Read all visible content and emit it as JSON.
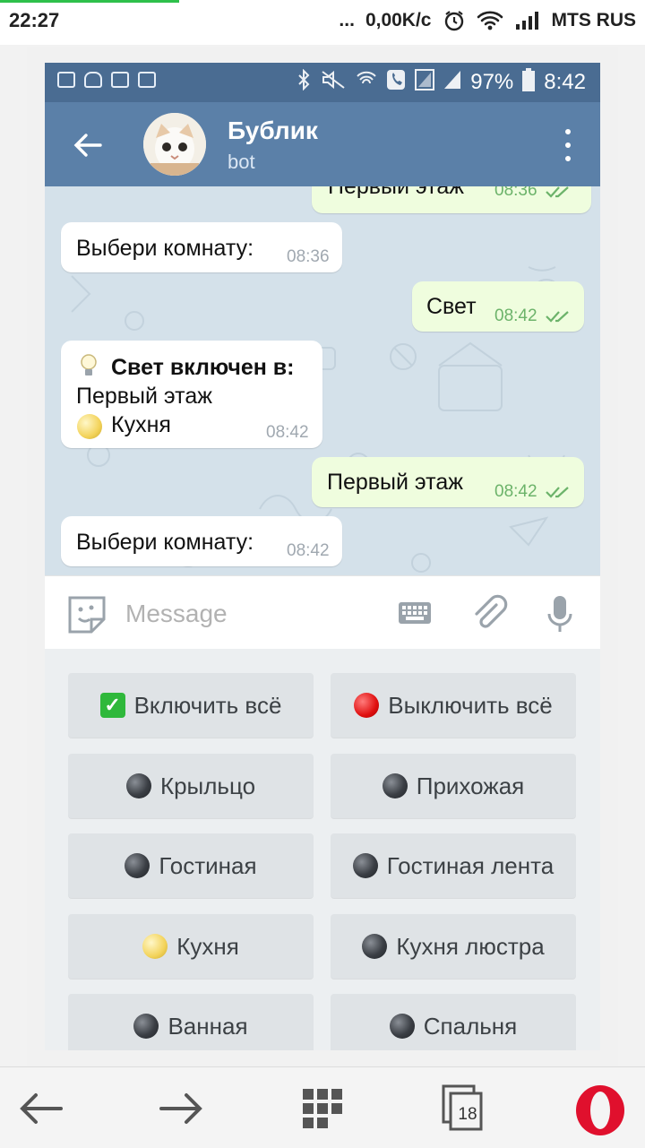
{
  "device_status": {
    "time": "22:27",
    "dots": "...",
    "speed": "0,00K/c",
    "carrier": "MTS RUS",
    "icons": [
      "alarm-icon",
      "wifi-icon",
      "signal-icon"
    ]
  },
  "phone_status": {
    "battery": "97%",
    "time": "8:42",
    "icons": [
      "gallery-icon",
      "android-icon",
      "mail-icon",
      "clipboard-icon",
      "bluetooth-icon",
      "mute-icon",
      "wifi-call-icon",
      "phone-icon",
      "sim-icon",
      "signal-icon",
      "battery-icon"
    ]
  },
  "header": {
    "title": "Бублик",
    "subtitle": "bot"
  },
  "messages": [
    {
      "dir": "out",
      "text": "Первый этаж",
      "time": "08:36",
      "read": true
    },
    {
      "dir": "in",
      "text": "Выбери комнату:",
      "time": "08:36"
    },
    {
      "dir": "out",
      "text": "Свет",
      "time": "08:42",
      "read": true
    },
    {
      "dir": "in",
      "bold": "Свет включен в:",
      "line2": "Первый этаж",
      "line3": "Кухня",
      "time": "08:42"
    },
    {
      "dir": "out",
      "text": "Первый этаж",
      "time": "08:42",
      "read": true
    },
    {
      "dir": "in",
      "text": "Выбери комнату:",
      "time": "08:42"
    }
  ],
  "input": {
    "placeholder": "Message"
  },
  "keyboard": [
    {
      "label": "Включить всё",
      "icon": "check-icon"
    },
    {
      "label": "Выключить всё",
      "icon": "red-circle-icon"
    },
    {
      "label": "Крыльцо",
      "icon": "dark-circle-icon"
    },
    {
      "label": "Прихожая",
      "icon": "dark-circle-icon"
    },
    {
      "label": "Гостиная",
      "icon": "dark-circle-icon"
    },
    {
      "label": "Гостиная лента",
      "icon": "dark-circle-icon"
    },
    {
      "label": "Кухня",
      "icon": "bulb-circle-icon"
    },
    {
      "label": "Кухня люстра",
      "icon": "dark-circle-icon"
    },
    {
      "label": "Ванная",
      "icon": "dark-circle-icon"
    },
    {
      "label": "Спальня",
      "icon": "dark-circle-icon"
    }
  ],
  "browser_bar": {
    "tabs_count": "18"
  },
  "colors": {
    "header": "#5b80a8",
    "status": "#4a6c92",
    "out_bubble": "#effdde",
    "time_out": "#6cb36a",
    "opera_red": "#e0102d"
  }
}
